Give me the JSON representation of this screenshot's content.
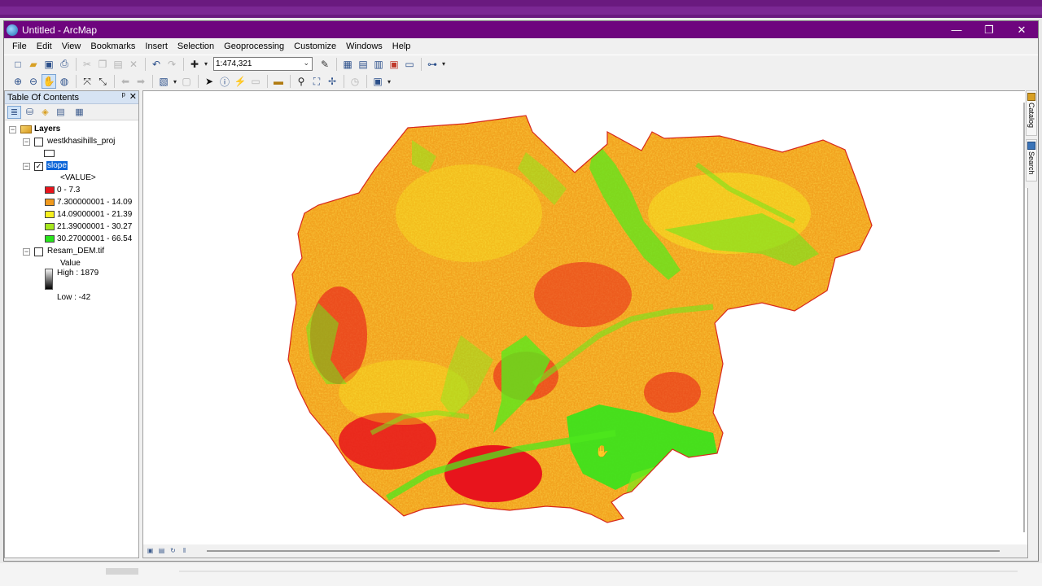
{
  "window": {
    "title": "Untitled - ArcMap"
  },
  "window_controls": {
    "minimize": "—",
    "restore": "❐",
    "close": "✕"
  },
  "menu": [
    "File",
    "Edit",
    "View",
    "Bookmarks",
    "Insert",
    "Selection",
    "Geoprocessing",
    "Customize",
    "Windows",
    "Help"
  ],
  "toolbar": {
    "scale": "1:474,321"
  },
  "toc": {
    "title": "Table Of Contents",
    "pin": "ᵖ",
    "close": "✕",
    "root": "Layers",
    "layers": [
      {
        "name": "westkhasihills_proj",
        "checked": false
      },
      {
        "name": "slope",
        "checked": true,
        "field": "<VALUE>",
        "classes": [
          {
            "label": "0 - 7.3",
            "color": "#e8141c"
          },
          {
            "label": "7.300000001 - 14.09",
            "color": "#f09a1e"
          },
          {
            "label": "14.09000001 - 21.39",
            "color": "#f6f01e"
          },
          {
            "label": "21.39000001 - 30.27",
            "color": "#a6e81e"
          },
          {
            "label": "30.27000001 - 66.54",
            "color": "#28e41c"
          }
        ]
      },
      {
        "name": "Resam_DEM.tif",
        "checked": false,
        "value_label": "Value",
        "high": "High : 1879",
        "low": "Low : -42"
      }
    ]
  },
  "side_tabs": [
    "Catalog",
    "Search"
  ],
  "colors": {
    "title_bar": "#6e057e",
    "slope_low": "#e8141c",
    "slope_mid": "#f09a1e",
    "slope_high": "#28e41c"
  }
}
